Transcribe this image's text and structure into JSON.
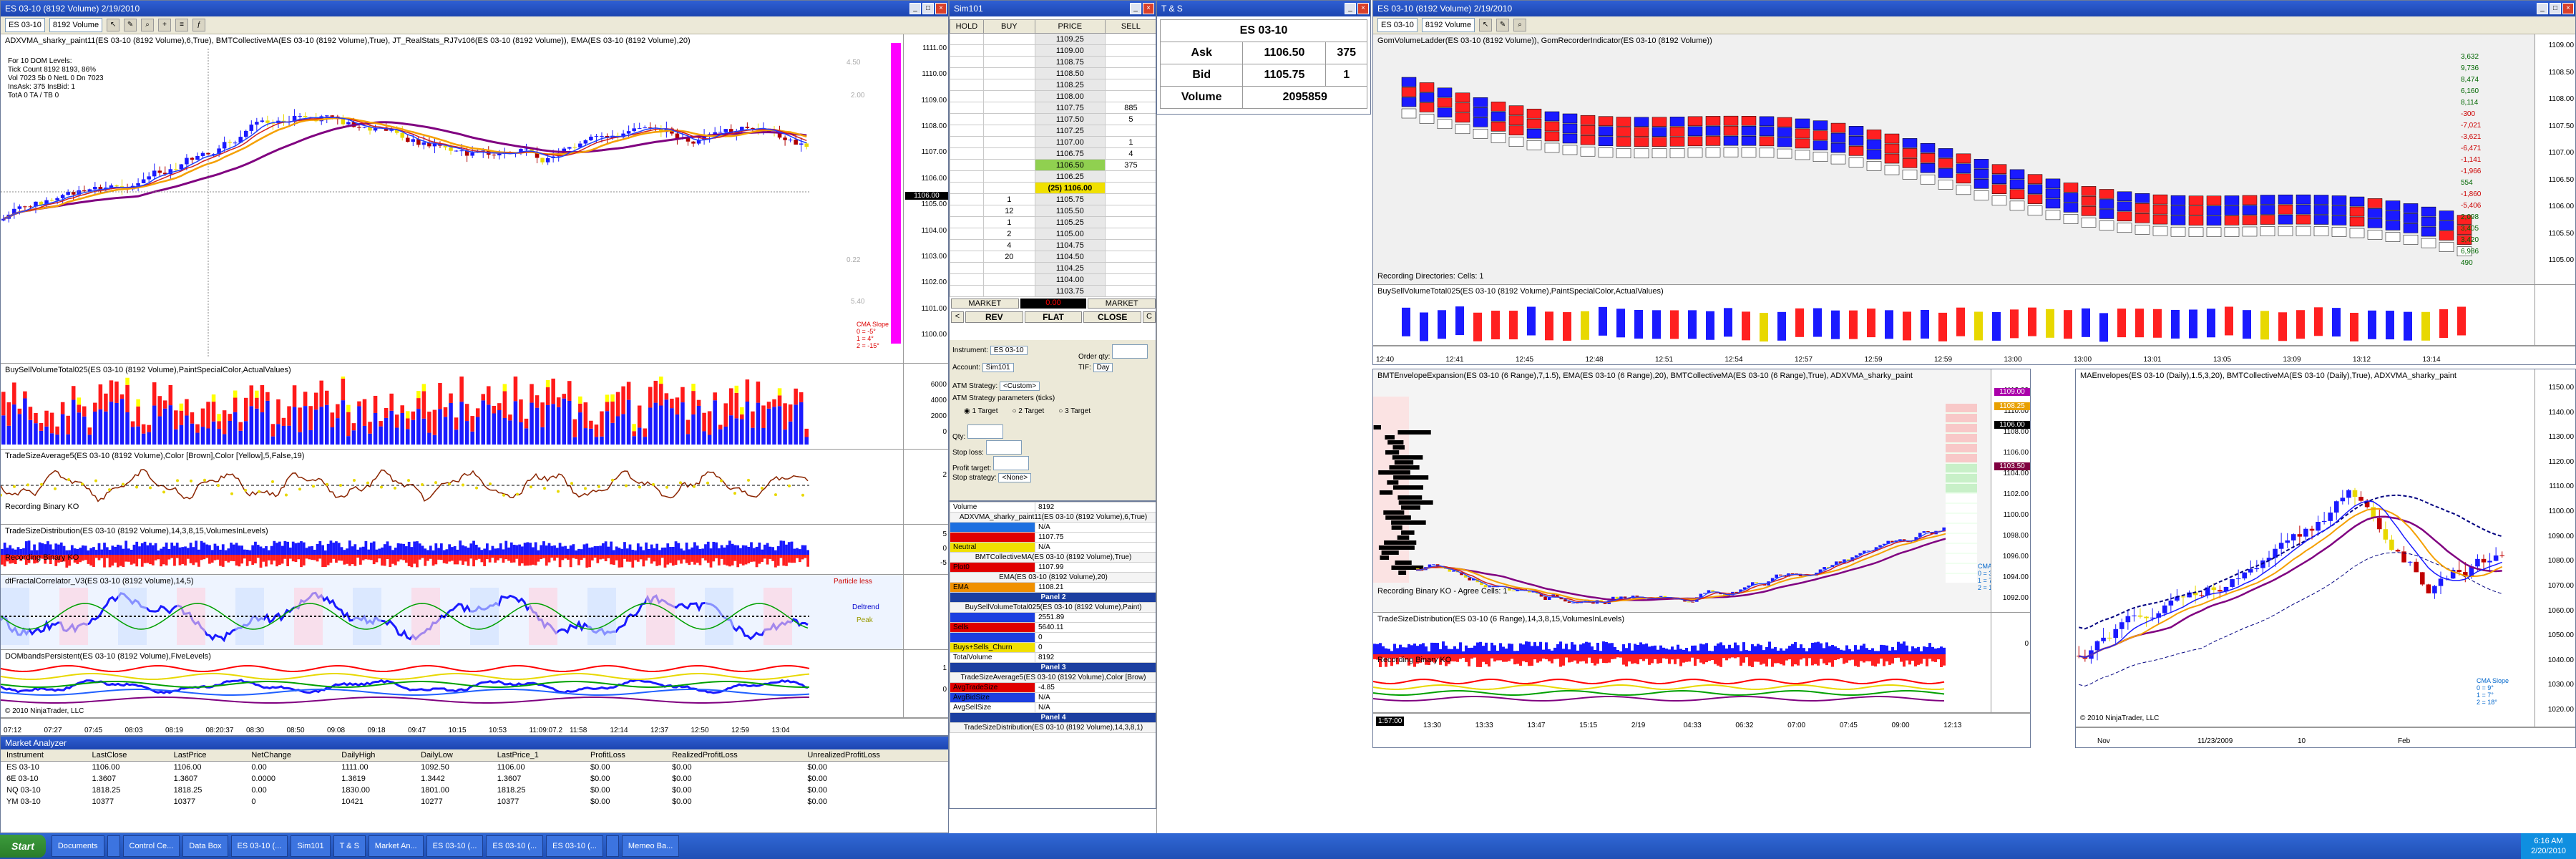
{
  "chart_left": {
    "title": "ES 03-10 (8192 Volume)  2/19/2010",
    "instrument": "ES 03-10",
    "period": "8192 Volume",
    "pane1_label": "ADXVMA_sharky_paint11(ES 03-10 (8192 Volume),6,True), BMTCollectiveMA(ES 03-10 (8192 Volume),True), JT_RealStats_RJ7v106(ES 03-10 (8192 Volume)), EMA(ES 03-10 (8192 Volume),20)",
    "stats": [
      "For 10 DOM Levels:",
      "Tick Count 8192 8193, 86%",
      "Vol 7023   5b 0  NetL 0   Dn 7023",
      "InsAsk: 375   InsBid: 1",
      "TotA 0   TA / TB 0"
    ],
    "price_ticks": [
      "1111.00",
      "1110.00",
      "1109.00",
      "1108.00",
      "1107.00",
      "1106.00",
      "1105.00",
      "1104.00",
      "1103.00",
      "1102.00",
      "1101.00",
      "1100.00"
    ],
    "current_price": "1106.00",
    "pane2_label": "BuySellVolumeTotal025(ES 03-10 (8192 Volume),PaintSpecialColor,ActualValues)",
    "pane3_label": "TradeSizeAverage5(ES 03-10 (8192 Volume),Color [Brown],Color [Yellow],5,False,19)",
    "pane3_sub": "Recording Binary KO",
    "pane4_label": "TradeSizeDistribution(ES 03-10 (8192 Volume),14,3,8,15,VolumesInLevels)",
    "pane4_sub": "Recording Binary KO",
    "pane5_label": "dtFractalCorrelator_V3(ES 03-10 (8192 Volume),14,5)",
    "pane5_tags": [
      "Particle less",
      "Deltrend",
      "Peak"
    ],
    "pane6_label": "DOMbandsPersistent(ES 03-10 (8192 Volume),FiveLevels)",
    "copyright": "© 2010 NinjaTrader, LLC",
    "cma": [
      "CMA Slope",
      "0 = -5°",
      "1 = 4°",
      "2 = -15°"
    ],
    "side_values": [
      "4.50",
      "2.00",
      "0.22",
      "5.40"
    ],
    "times": [
      "07:12",
      "07:27",
      "07:45",
      "08:03",
      "08:19",
      "08:20:37",
      "08:30",
      "08:50",
      "09:08",
      "09:18",
      "09:47",
      "10:15",
      "10:53",
      "11:09:07.2",
      "11:58",
      "12:14",
      "12:37",
      "12:50",
      "12:59",
      "13:04"
    ],
    "pane2_ticks": [
      "6000",
      "4000",
      "2000",
      "0"
    ],
    "pane3_ticks": [
      "2"
    ],
    "pane4_ticks": [
      "5",
      "0",
      "-5"
    ],
    "pane6_ticks": [
      "1",
      "0"
    ]
  },
  "dom": {
    "title": "Sim101",
    "headers": [
      "HOLD",
      "BUY",
      "PRICE",
      "SELL"
    ],
    "rows": [
      {
        "buy": "",
        "price": "1109.25",
        "sell": ""
      },
      {
        "buy": "",
        "price": "1109.00",
        "sell": ""
      },
      {
        "buy": "",
        "price": "1108.75",
        "sell": ""
      },
      {
        "buy": "",
        "price": "1108.50",
        "sell": ""
      },
      {
        "buy": "",
        "price": "1108.25",
        "sell": ""
      },
      {
        "buy": "",
        "price": "1108.00",
        "sell": ""
      },
      {
        "buy": "",
        "price": "1107.75",
        "sell": "885"
      },
      {
        "buy": "",
        "price": "1107.50",
        "sell": "5"
      },
      {
        "buy": "",
        "price": "1107.25",
        "sell": ""
      },
      {
        "buy": "",
        "price": "1107.00",
        "sell": "1"
      },
      {
        "buy": "",
        "price": "1106.75",
        "sell": "4"
      },
      {
        "buy": "",
        "price": "1106.50",
        "sell": "375"
      },
      {
        "buy": "",
        "price": "1106.25",
        "sell": ""
      },
      {
        "buy": "",
        "price": "(25) 1106.00",
        "sell": ""
      },
      {
        "buy": "1",
        "price": "1105.75",
        "sell": ""
      },
      {
        "buy": "12",
        "price": "1105.50",
        "sell": ""
      },
      {
        "buy": "1",
        "price": "1105.25",
        "sell": ""
      },
      {
        "buy": "2",
        "price": "1105.00",
        "sell": ""
      },
      {
        "buy": "4",
        "price": "1104.75",
        "sell": ""
      },
      {
        "buy": "20",
        "price": "1104.50",
        "sell": ""
      },
      {
        "buy": "",
        "price": "1104.25",
        "sell": ""
      },
      {
        "buy": "",
        "price": "1104.00",
        "sell": ""
      },
      {
        "buy": "",
        "price": "1103.75",
        "sell": ""
      }
    ],
    "market_buy": "MARKET",
    "market_sell": "MARKET",
    "pnl": "0.00",
    "rev": "REV",
    "flat": "FLAT",
    "close": "CLOSE",
    "instrument_label": "Instrument:",
    "instrument": "ES 03-10",
    "order_qty_label": "Order qty:",
    "account_label": "Account:",
    "account": "Sim101",
    "tif_label": "TIF:",
    "tif": "Day",
    "atm_label": "ATM Strategy:",
    "atm": "<Custom>",
    "atm_params": "ATM Strategy parameters (ticks)",
    "targets": [
      "1 Target",
      "2 Target",
      "3 Target"
    ],
    "qty_label": "Qty:",
    "stop_loss_label": "Stop loss:",
    "profit_target_label": "Profit target:",
    "stop_strategy_label": "Stop strategy:",
    "stop_strategy": "<None>"
  },
  "databox": {
    "rows": [
      {
        "k": "Volume",
        "v": "8192"
      },
      {
        "k": "ADXVMA_sharky_paint11(ES 03-10 (8192 Volume),6,True)",
        "v": "",
        "hdr": true
      },
      {
        "k": "",
        "v": "N/A",
        "color": "#1c6fe0"
      },
      {
        "k": "",
        "v": "1107.75",
        "color": "#e00000"
      },
      {
        "k": "Neutral",
        "v": "N/A",
        "color": "#f0e000"
      },
      {
        "k": "BMTCollectiveMA(ES 03-10 (8192 Volume),True)",
        "v": "",
        "hdr": true
      },
      {
        "k": "Plot0",
        "v": "1107.99",
        "color": "#e00000"
      },
      {
        "k": "EMA(ES 03-10 (8192 Volume),20)",
        "v": "",
        "hdr": true
      },
      {
        "k": "EMA",
        "v": "1108.21",
        "color": "#f09000"
      },
      {
        "k": "Panel 2",
        "v": "",
        "panel": true
      },
      {
        "k": "BuySellVolumeTotal025(ES 03-10 (8192 Volume),Paint)",
        "v": "",
        "hdr": true
      },
      {
        "k": "",
        "v": "2551.89",
        "color": "#1c3fe0"
      },
      {
        "k": "Sells",
        "v": "5640.11",
        "color": "#e00000"
      },
      {
        "k": "",
        "v": "0",
        "color": "#1c3fe0"
      },
      {
        "k": "Buys+Sells_Churn",
        "v": "0",
        "color": "#f0e000"
      },
      {
        "k": "TotalVolume",
        "v": "8192"
      },
      {
        "k": "Panel 3",
        "v": "",
        "panel": true
      },
      {
        "k": "TradeSizeAverage5(ES 03-10 (8192 Volume),Color [Brow)",
        "v": "",
        "hdr": true
      },
      {
        "k": "AvgTradeSize",
        "v": "-4.85",
        "color": "#e00000"
      },
      {
        "k": "AvgBidSize",
        "v": "N/A",
        "color": "#1c3fe0"
      },
      {
        "k": "AvgSellSize",
        "v": "N/A"
      },
      {
        "k": "Panel 4",
        "v": "",
        "panel": true
      },
      {
        "k": "TradeSizeDistribution(ES 03-10 (8192 Volume),14,3,8,1)",
        "v": "",
        "hdr": true
      }
    ]
  },
  "tas": {
    "title": "T & S",
    "instrument": "ES 03-10",
    "ask_label": "Ask",
    "ask": "1106.50",
    "ask_size": "375",
    "bid_label": "Bid",
    "bid": "1105.75",
    "bid_size": "1",
    "volume_label": "Volume",
    "volume": "2095859"
  },
  "market_analyzer": {
    "title": "Market Analyzer",
    "columns": [
      "Instrument",
      "LastClose",
      "LastPrice",
      "NetChange",
      "DailyHigh",
      "DailyLow",
      "LastPrice_1",
      "ProfitLoss",
      "RealizedProfitLoss",
      "UnrealizedProfitLoss"
    ],
    "rows": [
      [
        "ES 03-10",
        "1106.00",
        "1106.00",
        "0.00",
        "1111.00",
        "1092.50",
        "1106.00",
        "$0.00",
        "$0.00",
        "$0.00"
      ],
      [
        "6E 03-10",
        "1.3607",
        "1.3607",
        "0.0000",
        "1.3619",
        "1.3442",
        "1.3607",
        "$0.00",
        "$0.00",
        "$0.00"
      ],
      [
        "NQ 03-10",
        "1818.25",
        "1818.25",
        "0.00",
        "1830.00",
        "1801.00",
        "1818.25",
        "$0.00",
        "$0.00",
        "$0.00"
      ],
      [
        "YM 03-10",
        "10377",
        "10377",
        "0",
        "10421",
        "10277",
        "10377",
        "$0.00",
        "$0.00",
        "$0.00"
      ]
    ]
  },
  "chart_right": {
    "title": "ES 03-10 (8192 Volume)  2/19/2010",
    "instrument": "ES 03-10",
    "period": "8192 Volume",
    "pane1_label": "GomVolumeLadder(ES 03-10 (8192 Volume)), GomRecorderIndicator(ES 03-10 (8192 Volume))",
    "recording": "Recording Directories: Cells: 1",
    "pane2_label": "BuySellVolumeTotal025(ES 03-10 (8192 Volume),PaintSpecialColor,ActualValues)",
    "times": [
      "12:40",
      "12:41",
      "12:45",
      "12:48",
      "12:51",
      "12:54",
      "12:57",
      "12:59",
      "12:59",
      "13:00",
      "13:00",
      "13:01",
      "13:05",
      "13:09",
      "13:12",
      "13:14"
    ],
    "right_ticks": [
      "1109.00",
      "1108.50",
      "1108.00",
      "1107.50",
      "1107.00",
      "1106.50",
      "1106.00",
      "1105.50",
      "1105.00"
    ],
    "ladder_values": [
      "3,632",
      "9,736",
      "8,474",
      "6,160",
      "8,114",
      "-300",
      "-7,021",
      "-3,621",
      "-6,471",
      "-1,141",
      "-1,966",
      "554",
      "-1,860",
      "-5,406",
      "2,098",
      "3,405",
      "3,420",
      "6,986",
      "490"
    ]
  },
  "chart_range": {
    "pane1_label": "BMTEnvelopeExpansion(ES 03-10 (6 Range),7,1.5), EMA(ES 03-10 (6 Range),20), BMTCollectiveMA(ES 03-10 (6 Range),True), ADXVMA_sharky_paint",
    "ticks": [
      "1112.00",
      "1110.00",
      "1108.00",
      "1106.00",
      "1104.00",
      "1102.00",
      "1100.00",
      "1098.00",
      "1096.00",
      "1094.00",
      "1092.00"
    ],
    "sub": "Recording Binary KO - Agree Cells: 1",
    "pane2_label": "TradeSizeDistribution(ES 03-10 (6 Range),14,3,8,15,VolumesInLevels)",
    "pane2_sub": "Recording Binary KO",
    "times": [
      "13:30",
      "13:33",
      "13:47",
      "15:15",
      "2/19",
      "04:33",
      "06:32",
      "07:00",
      "07:45",
      "09:00",
      "12:13"
    ],
    "time_left": "1:57:00",
    "cma": [
      "CMA Slope",
      "0 = 3°",
      "1 = 7°",
      "2 = 15°"
    ],
    "pane2_ticks": [
      "0"
    ],
    "price_tags": [
      "1109.00",
      "1108.25",
      "1106.00",
      "1103.50"
    ]
  },
  "chart_daily": {
    "label": "MAEnvelopes(ES 03-10 (Daily),1.5,3,20), BMTCollectiveMA(ES 03-10 (Daily),True), ADXVMA_sharky_paint",
    "ticks": [
      "1150.00",
      "1140.00",
      "1130.00",
      "1120.00",
      "1110.00",
      "1100.00",
      "1090.00",
      "1080.00",
      "1070.00",
      "1060.00",
      "1050.00",
      "1040.00",
      "1030.00",
      "1020.00"
    ],
    "times": [
      "Nov",
      "11/23/2009",
      "10",
      "Feb"
    ],
    "copyright": "© 2010 NinjaTrader, LLC",
    "cma": [
      "CMA Slope",
      "0 = 9°",
      "1 = 7°",
      "2 = 18°"
    ]
  },
  "taskbar": {
    "start": "Start",
    "items": [
      "Documents",
      "",
      "Control Ce...",
      "Data Box",
      "ES 03-10 (...",
      "Sim101",
      "T & S",
      "Market An...",
      "ES 03-10 (...",
      "ES 03-10 (...",
      "ES 03-10 (...",
      "",
      "Memeo Ba..."
    ],
    "clock": "6:16 AM",
    "date": "2/20/2010"
  },
  "colors": {
    "title_blue": "#1c45b0",
    "buy_blue": "#0000ff",
    "sell_red": "#ff0000",
    "magenta": "#ff00ff",
    "yellow": "#ffff00"
  }
}
